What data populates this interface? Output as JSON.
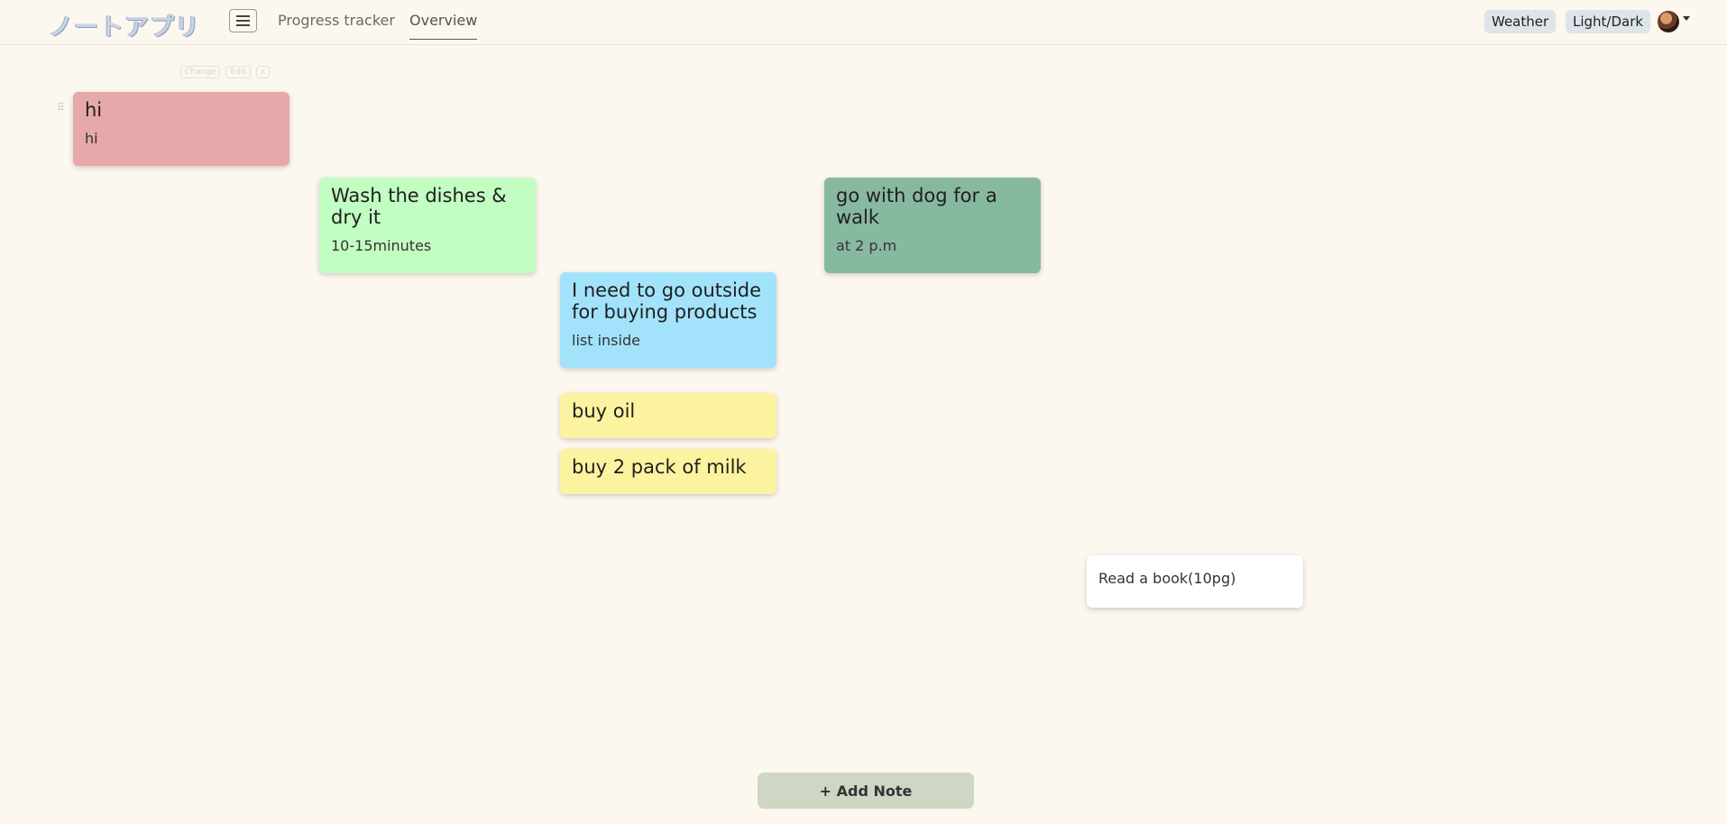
{
  "header": {
    "logo": "ノートアプリ",
    "nav": [
      {
        "label": "Progress tracker"
      },
      {
        "label": "Overview"
      }
    ],
    "weather_label": "Weather",
    "theme_label": "Light/Dark"
  },
  "note_controls": [
    "Change",
    "Edit",
    "x"
  ],
  "notes": [
    {
      "title": "hi",
      "body": "hi",
      "color": "#e6a8a9"
    },
    {
      "title": "Wash the dishes & dry it",
      "body": "10-15minutes",
      "color": "#c2fdc1"
    },
    {
      "title": "go with dog for a walk",
      "body": "at 2 p.m",
      "color": "#87b9a0"
    },
    {
      "title": "I need to go outside for buying products",
      "body": "list inside",
      "color": "#a2e3fb"
    },
    {
      "title": "buy oil",
      "body": "",
      "color": "#fbf39f"
    },
    {
      "title": "buy 2 pack of milk",
      "body": "",
      "color": "#fbf39f"
    },
    {
      "title": "",
      "body": "Read a book(10pg)",
      "color": "#ffffff"
    }
  ],
  "add_button": "+ Add Note"
}
